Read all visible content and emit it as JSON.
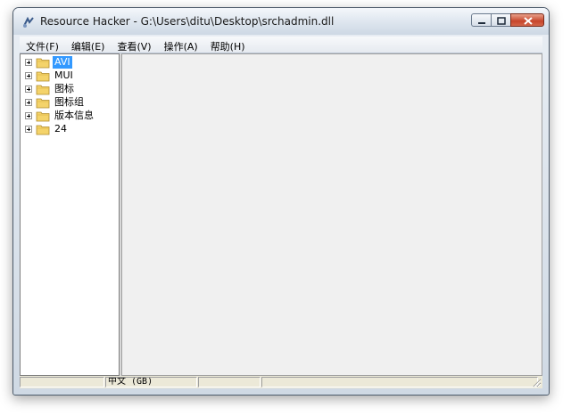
{
  "window": {
    "title": "Resource Hacker  -  G:\\Users\\ditu\\Desktop\\srchadmin.dll",
    "app_icon": "resource-hacker-icon"
  },
  "menu": {
    "items": [
      {
        "label": "文件(F)"
      },
      {
        "label": "编辑(E)"
      },
      {
        "label": "查看(V)"
      },
      {
        "label": "操作(A)"
      },
      {
        "label": "帮助(H)"
      }
    ]
  },
  "tree": {
    "items": [
      {
        "label": "AVI",
        "selected": true
      },
      {
        "label": "MUI"
      },
      {
        "label": "图标"
      },
      {
        "label": "图标组"
      },
      {
        "label": "版本信息"
      },
      {
        "label": "24"
      }
    ]
  },
  "status": {
    "input_method": "中文 (GB)",
    "cells": [
      "",
      "",
      "",
      ""
    ]
  },
  "colors": {
    "selection": "#3399ff",
    "folder": "#f4d36a",
    "close_button": "#c7452b"
  }
}
